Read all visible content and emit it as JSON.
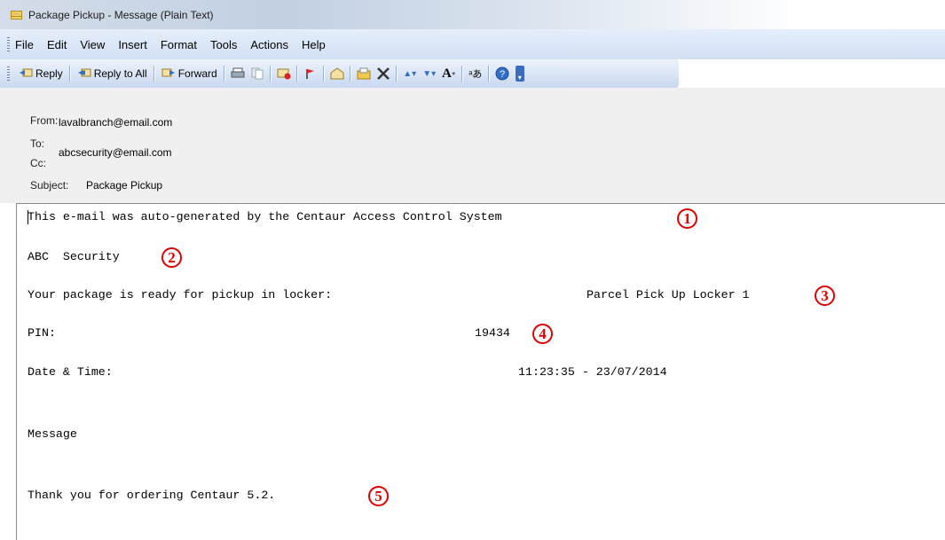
{
  "window": {
    "title": "Package Pickup - Message (Plain Text)",
    "icon": "envelope-icon"
  },
  "menu": {
    "items": [
      "File",
      "Edit",
      "View",
      "Insert",
      "Format",
      "Tools",
      "Actions",
      "Help"
    ]
  },
  "toolbar": {
    "reply_label": "Reply",
    "reply_all_label": "Reply to All",
    "forward_label": "Forward",
    "font_size_glyph": "A"
  },
  "header": {
    "from_label": "From:",
    "from_value": "lavalbranch@email.com",
    "to_label": "To:",
    "to_value": "abcsecurity@email.com",
    "cc_label": "Cc:",
    "subject_label": "Subject:",
    "subject_value": "Package Pickup"
  },
  "body": {
    "line1": "This e-mail was auto-generated by the Centaur Access Control System",
    "line2": "ABC  Security",
    "line3_label": "Your package is ready for pickup in locker:",
    "line3_value": "Parcel Pick Up Locker 1",
    "pin_label": "PIN:",
    "pin_value": "19434",
    "datetime_label": "Date & Time:",
    "datetime_value": "11:23:35 - 23/07/2014",
    "message_label": "Message",
    "closing": "Thank you for ordering Centaur 5.2."
  },
  "callouts": [
    "1",
    "2",
    "3",
    "4",
    "5"
  ],
  "colors": {
    "callout": "#dd0000",
    "header_bg": "#f0f0f0",
    "toolbar_bg": "#c8d8f0"
  }
}
